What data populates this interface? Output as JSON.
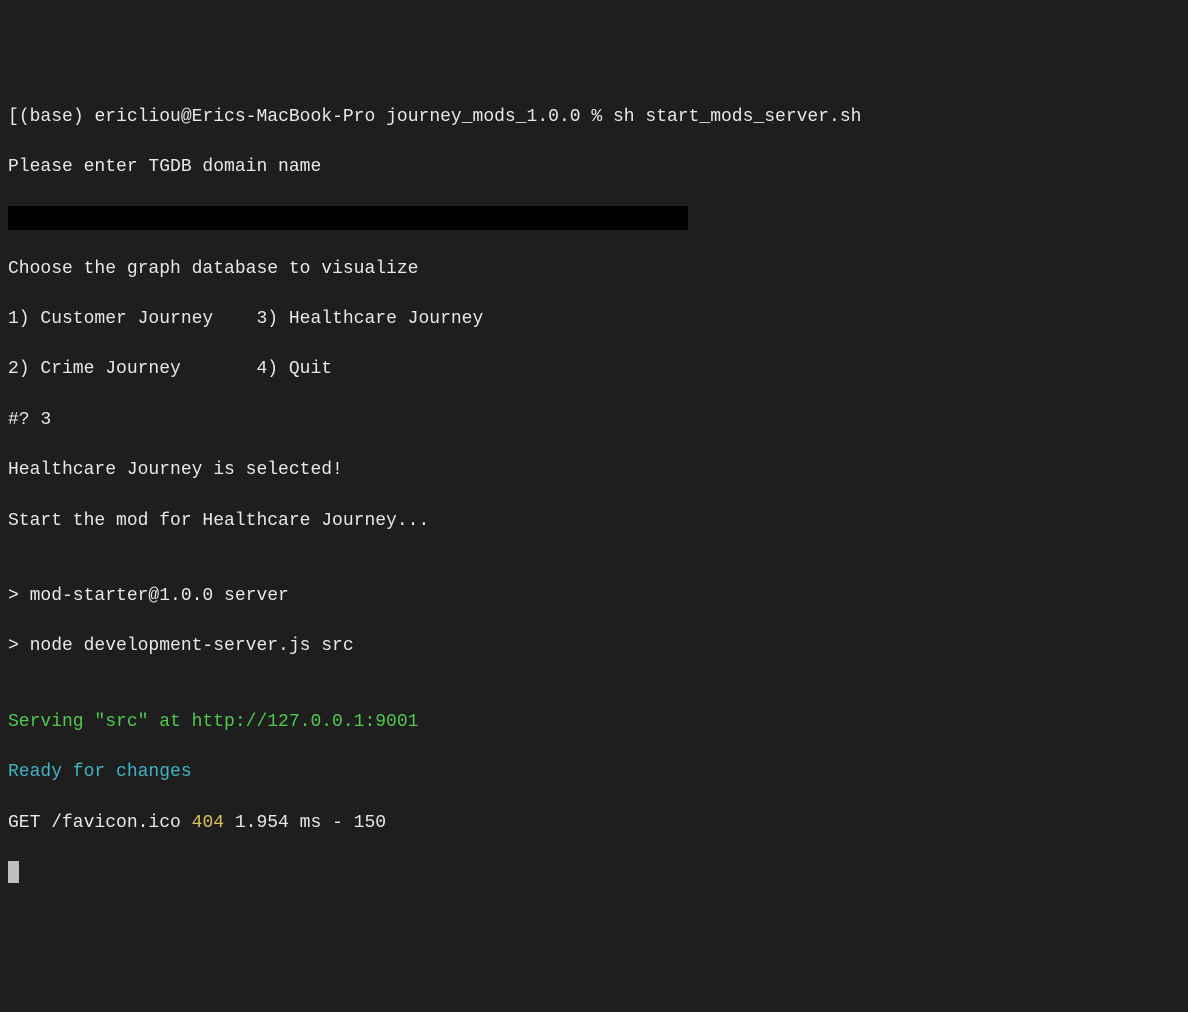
{
  "prompt": {
    "bracket_open": "[",
    "env": "(base)",
    "user_host": "ericliou@Erics-MacBook-Pro",
    "cwd": "journey_mods_1.0.0",
    "symbol": "%",
    "command": "sh start_mods_server.sh"
  },
  "lines": {
    "enter_domain": "Please enter TGDB domain name",
    "choose_db": "Choose the graph database to visualize",
    "opt1": "1) Customer Journey",
    "opt3": "3) Healthcare Journey",
    "opt2": "2) Crime Journey",
    "opt4": "4) Quit",
    "prompt_q": "#? ",
    "answer": "3",
    "selected": "Healthcare Journey is selected!",
    "start_mod": "Start the mod for Healthcare Journey...",
    "blank": "",
    "npm1": "> mod-starter@1.0.0 server",
    "npm2": "> node development-server.js src",
    "serving": "Serving \"src\" at http://127.0.0.1:9001",
    "ready": "Ready for changes",
    "http_method_path": "GET /favicon.ico ",
    "http_status": "404",
    "http_rest": " 1.954 ms - 150"
  }
}
